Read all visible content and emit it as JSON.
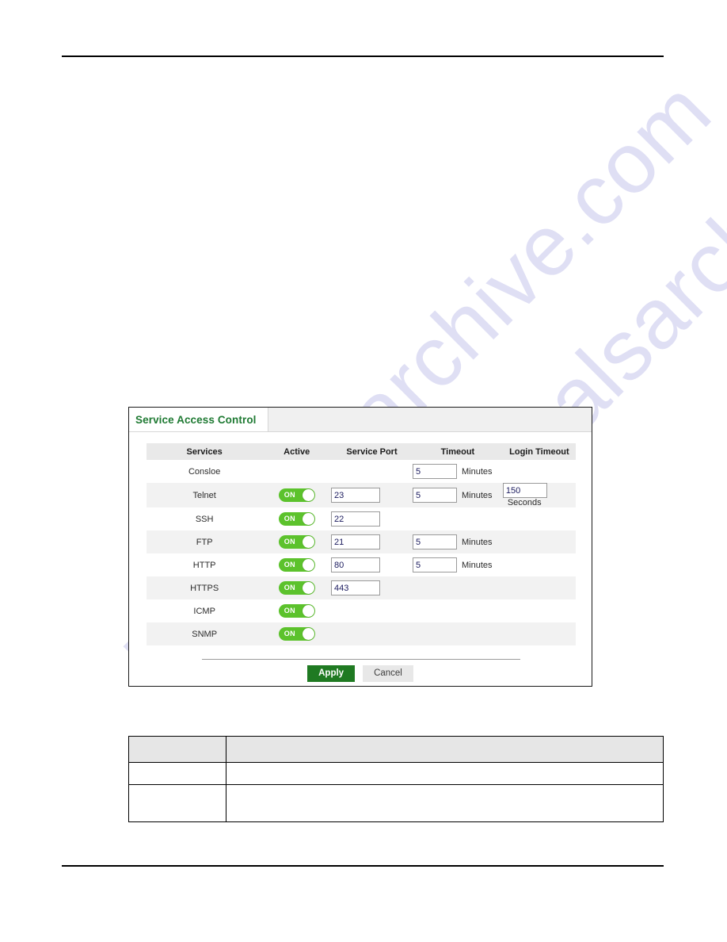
{
  "panel": {
    "tab_label": "Service Access Control",
    "columns": {
      "services": "Services",
      "active": "Active",
      "service_port": "Service Port",
      "timeout": "Timeout",
      "login_timeout": "Login Timeout"
    },
    "toggle_on_label": "ON",
    "rows": [
      {
        "service": "Consloe",
        "active": null,
        "port": null,
        "timeout": "5",
        "timeout_unit": "Minutes",
        "login_timeout": null,
        "login_unit": null
      },
      {
        "service": "Telnet",
        "active": "ON",
        "port": "23",
        "timeout": "5",
        "timeout_unit": "Minutes",
        "login_timeout": "150",
        "login_unit": "Seconds"
      },
      {
        "service": "SSH",
        "active": "ON",
        "port": "22",
        "timeout": null,
        "timeout_unit": null,
        "login_timeout": null,
        "login_unit": null
      },
      {
        "service": "FTP",
        "active": "ON",
        "port": "21",
        "timeout": "5",
        "timeout_unit": "Minutes",
        "login_timeout": null,
        "login_unit": null
      },
      {
        "service": "HTTP",
        "active": "ON",
        "port": "80",
        "timeout": "5",
        "timeout_unit": "Minutes",
        "login_timeout": null,
        "login_unit": null
      },
      {
        "service": "HTTPS",
        "active": "ON",
        "port": "443",
        "timeout": null,
        "timeout_unit": null,
        "login_timeout": null,
        "login_unit": null
      },
      {
        "service": "ICMP",
        "active": "ON",
        "port": null,
        "timeout": null,
        "timeout_unit": null,
        "login_timeout": null,
        "login_unit": null
      },
      {
        "service": "SNMP",
        "active": "ON",
        "port": null,
        "timeout": null,
        "timeout_unit": null,
        "login_timeout": null,
        "login_unit": null
      }
    ],
    "buttons": {
      "apply": "Apply",
      "cancel": "Cancel"
    }
  },
  "description_table": {
    "header": [
      "",
      ""
    ],
    "rows": [
      [
        "",
        ""
      ],
      [
        "",
        ""
      ]
    ]
  },
  "watermark": {
    "text": "manualsarchive.com"
  },
  "colors": {
    "accent_green": "#1f7a33",
    "toggle_green": "#5cc22c",
    "apply_green": "#1f7a22",
    "header_gray": "#e9e9e9",
    "stripe_gray": "#f2f2f2",
    "watermark_purple": "#b9b9e8"
  }
}
